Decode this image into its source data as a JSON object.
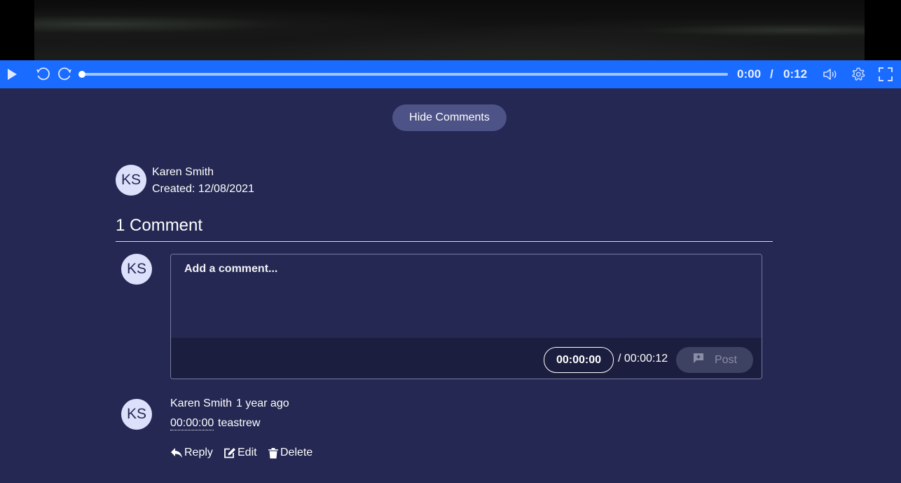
{
  "player": {
    "current_time": "0:00",
    "separator": "/",
    "duration": "0:12",
    "progress_fraction": 0,
    "icons": [
      "play-icon",
      "rewind-icon",
      "forward-icon",
      "volume-icon",
      "settings-icon",
      "fullscreen-icon"
    ]
  },
  "comments_toggle": {
    "label": "Hide Comments"
  },
  "video_owner": {
    "initials": "KS",
    "name": "Karen Smith",
    "created": "Created: 12/08/2021"
  },
  "comments_section": {
    "count_label": "1 Comment",
    "composer": {
      "initials": "KS",
      "placeholder": "Add a comment...",
      "timestamp": "00:00:00",
      "duration": "/ 00:00:12",
      "post_label": "Post"
    },
    "comments": [
      {
        "initials": "KS",
        "author": "Karen Smith",
        "time_ago": "1 year ago",
        "timestamp": "00:00:00",
        "text": "teastrew",
        "actions": {
          "reply": "Reply",
          "edit": "Edit",
          "delete": "Delete"
        }
      }
    ]
  },
  "colors": {
    "background": "#242852",
    "control_bar": "#1a6bff",
    "avatar": "#dde0fb",
    "button": "#4d5287"
  }
}
